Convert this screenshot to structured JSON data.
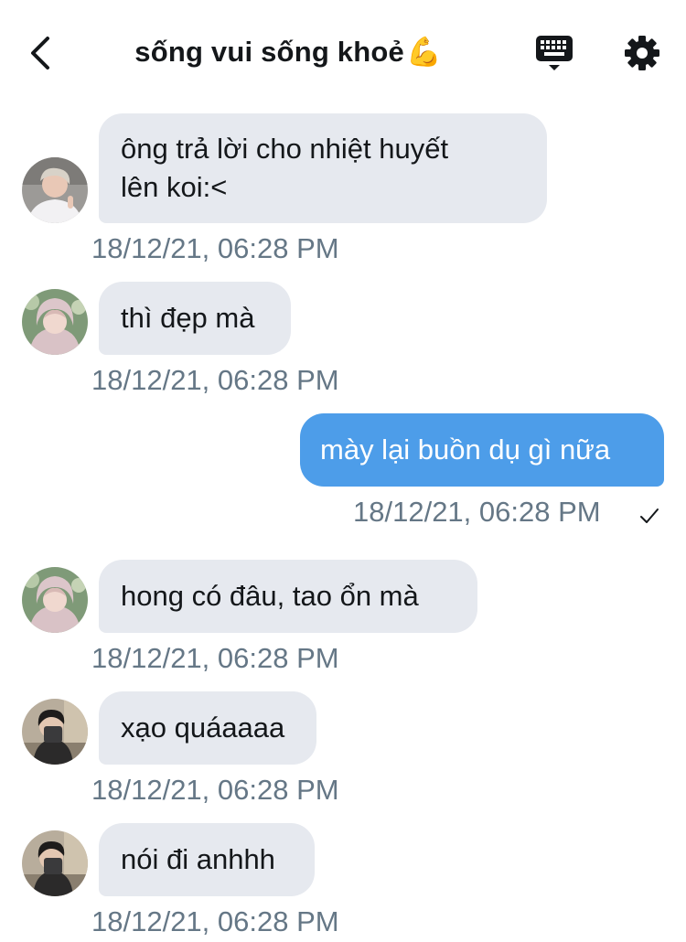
{
  "header": {
    "back_icon": "chevron-left-icon",
    "title": "sống vui sống khoẻ",
    "title_emoji": "💪",
    "keyboard_icon": "keyboard-icon",
    "settings_icon": "gear-icon"
  },
  "colors": {
    "incoming_bubble": "#e6e9ef",
    "outgoing_bubble": "#4d9de9",
    "timestamp": "#657786"
  },
  "messages": [
    {
      "direction": "incoming",
      "avatar": "user-avatar-1",
      "lines": [
        "ông trả lời cho nhiệt huyết",
        "lên koi:<"
      ],
      "timestamp": "18/12/21, 06:28 PM"
    },
    {
      "direction": "incoming",
      "avatar": "user-avatar-2",
      "lines": [
        "thì đẹp mà"
      ],
      "timestamp": "18/12/21, 06:28 PM"
    },
    {
      "direction": "outgoing",
      "lines": [
        "mày lại buồn dụ gì nữa"
      ],
      "timestamp": "18/12/21, 06:28 PM",
      "status_icon": "checkmark-icon"
    },
    {
      "direction": "incoming",
      "avatar": "user-avatar-2",
      "lines": [
        "hong có đâu, tao ổn mà"
      ],
      "timestamp": "18/12/21, 06:28 PM"
    },
    {
      "direction": "incoming",
      "avatar": "user-avatar-3",
      "lines": [
        "xạo quáaaaa"
      ],
      "timestamp": "18/12/21, 06:28 PM"
    },
    {
      "direction": "incoming",
      "avatar": "user-avatar-3",
      "lines": [
        "nói đi anhhh"
      ],
      "timestamp": "18/12/21, 06:28 PM"
    }
  ]
}
